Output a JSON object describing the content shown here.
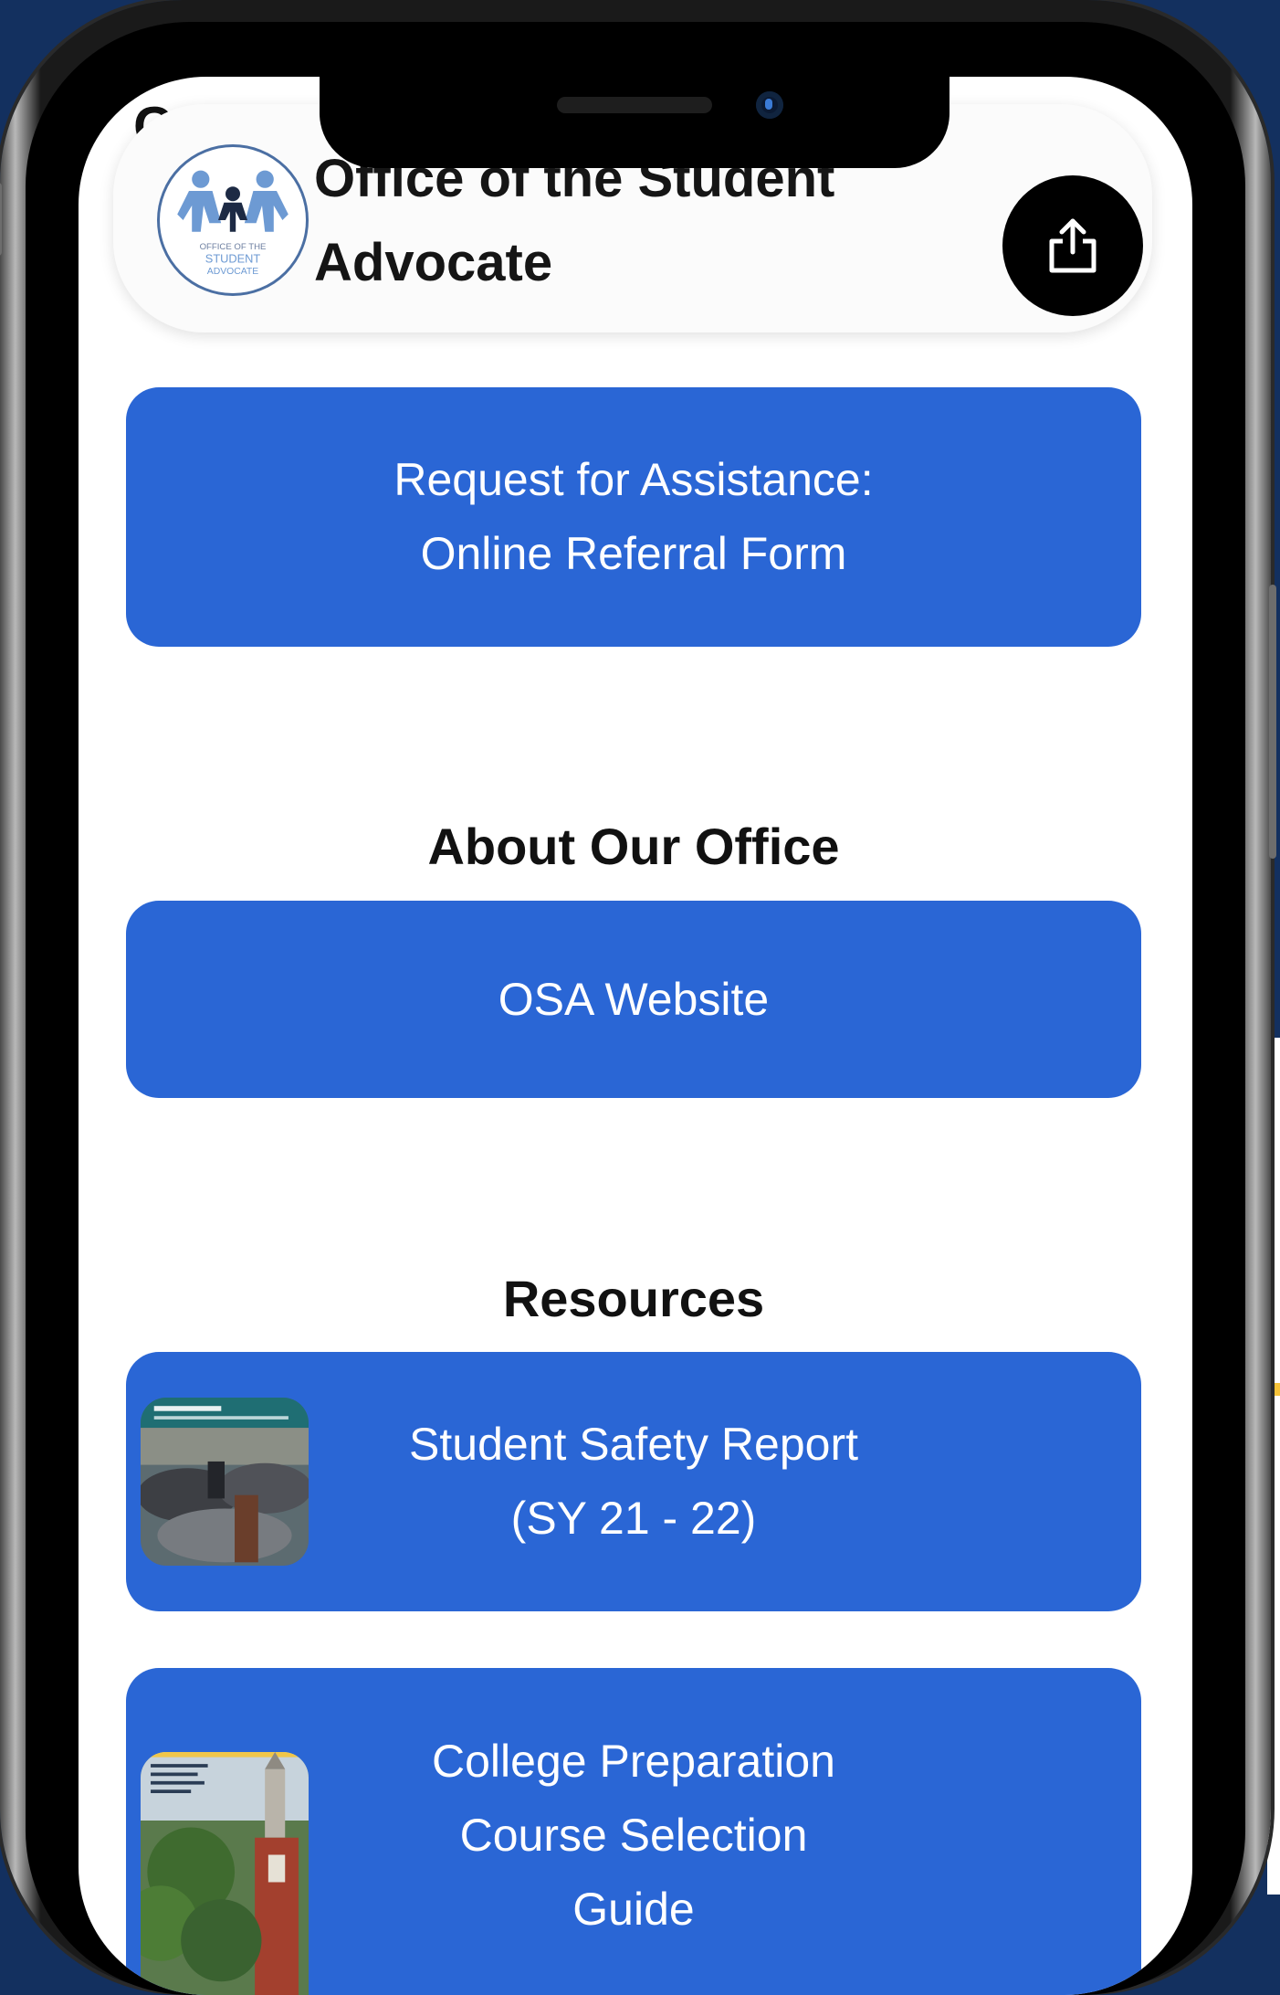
{
  "status": {
    "carrier_glyph": "C"
  },
  "header": {
    "title": "Office of the Student Advocate",
    "logo_text": "OFFICE OF THE STUDENT ADVOCATE"
  },
  "buttons": {
    "referral_line1": "Request for Assistance:",
    "referral_line2": "Online Referral Form",
    "osa_website": "OSA Website",
    "safety_line1": "Student Safety Report",
    "safety_line2": "(SY 21 - 22)",
    "college_line1": "College Preparation",
    "college_line2": "Course Selection",
    "college_line3": "Guide"
  },
  "sections": {
    "about": "About Our Office",
    "resources": "Resources"
  },
  "colors": {
    "button_blue": "#2a66d5",
    "page_background": "#13305f"
  },
  "icons": [
    "share-icon",
    "logo-icon"
  ]
}
